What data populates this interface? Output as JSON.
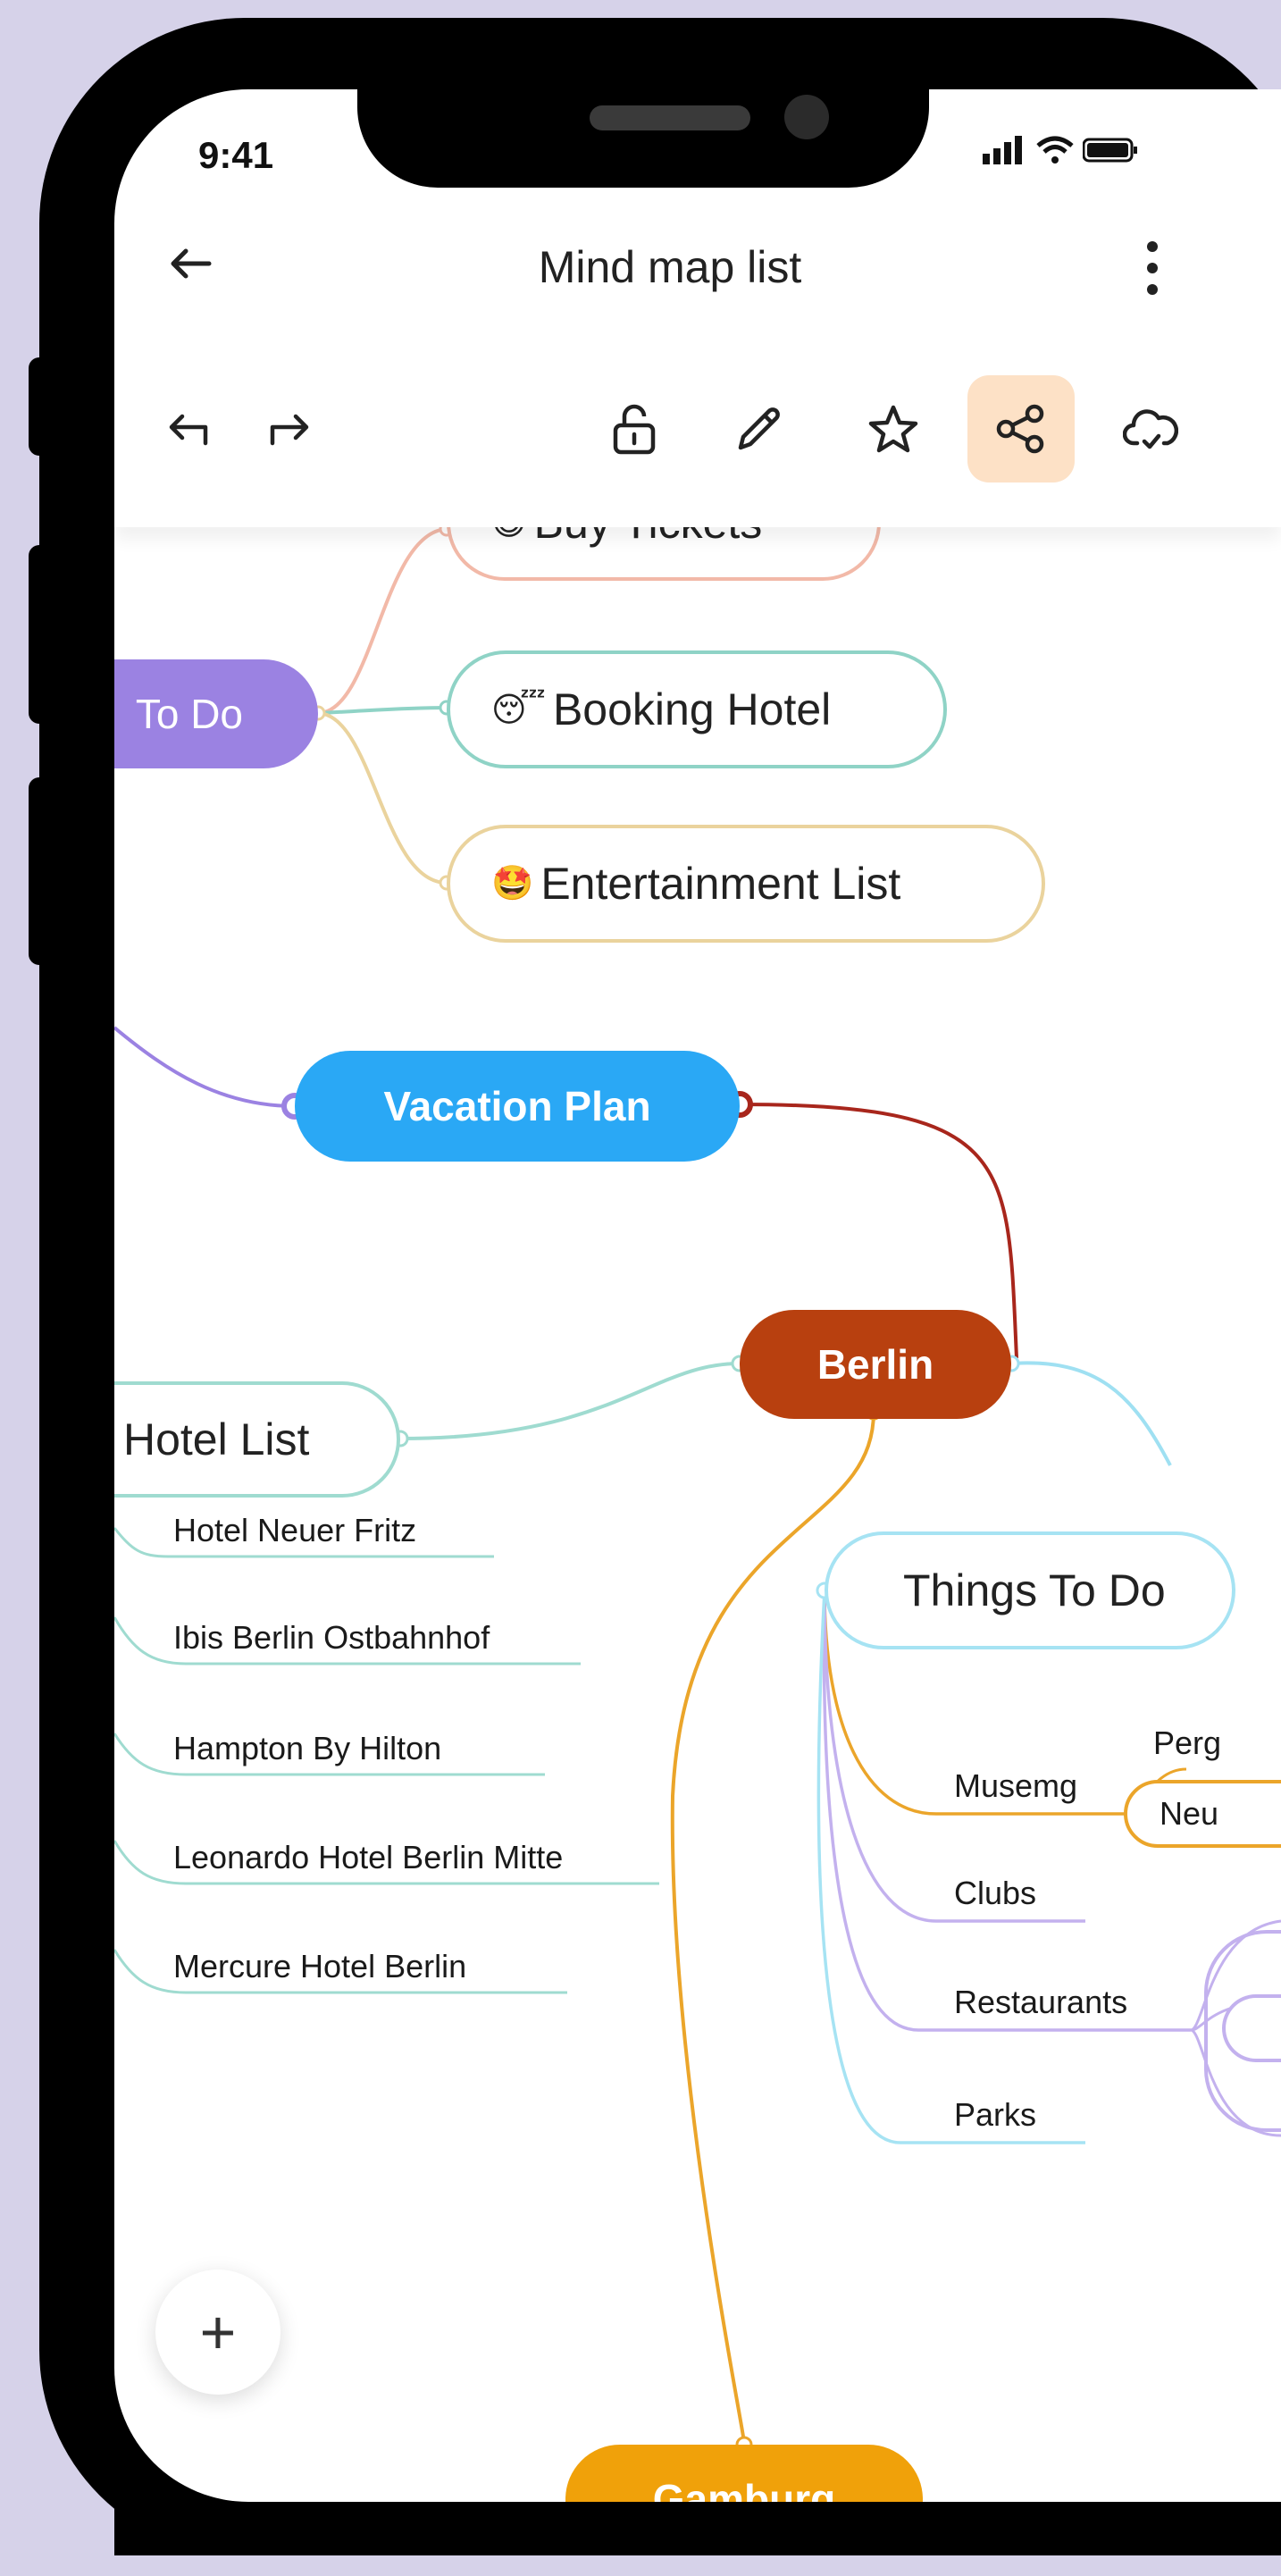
{
  "status": {
    "time": "9:41"
  },
  "header": {
    "title": "Mind map list"
  },
  "toolbar": {
    "icons": [
      "undo-icon",
      "redo-icon",
      "lock-icon",
      "pencil-icon",
      "star-icon",
      "share-icon",
      "cloud-sync-icon"
    ],
    "active": "share-icon",
    "accent_bg": "#fde1c6"
  },
  "mindmap": {
    "todo": {
      "label": "To Do",
      "color": "#9b82e2",
      "items": [
        {
          "emoji": "😄",
          "label": "Buy Tickets"
        },
        {
          "emoji": "😴",
          "label": "Booking Hotel"
        },
        {
          "emoji": "🤩",
          "label": "Entertainment List"
        }
      ]
    },
    "vacation_plan": {
      "label": "Vacation Plan",
      "color": "#2aa8f5"
    },
    "berlin": {
      "label": "Berlin",
      "color": "#b8400f"
    },
    "hotel_list": {
      "label": "Hotel List",
      "items": [
        "Hotel Neuer Fritz",
        "Ibis Berlin Ostbahnhof",
        "Hampton By Hilton",
        "Leonardo Hotel Berlin Mitte",
        "Mercure Hotel Berlin"
      ]
    },
    "things_to_do": {
      "label": "Things To Do",
      "items": [
        "Musemg",
        "Clubs",
        "Restaurants",
        "Parks"
      ],
      "museum_children": [
        "Perg",
        "Neu"
      ]
    },
    "gamburg": {
      "label": "Gamburg",
      "color": "#f0a10a"
    }
  },
  "fab": {
    "label": "+"
  }
}
